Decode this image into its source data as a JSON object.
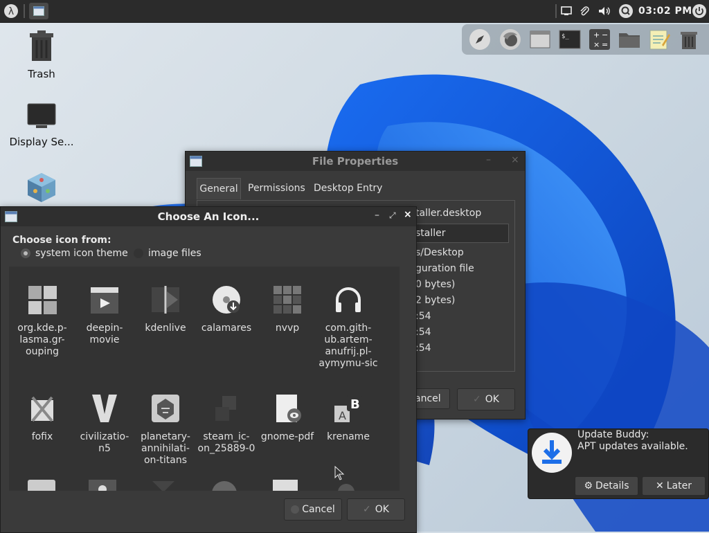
{
  "panel": {
    "clock": "03:02 PM"
  },
  "desktop": {
    "icons": [
      {
        "label": "Trash"
      },
      {
        "label": "Display Se..."
      }
    ]
  },
  "file_properties": {
    "title": "File Properties",
    "tabs": [
      "General",
      "Permissions",
      "Desktop Entry"
    ],
    "lines": [
      "taller.desktop",
      "staller",
      "s/Desktop",
      "guration file",
      "0 bytes)",
      "2 bytes)",
      ":54",
      ":54",
      ":54"
    ],
    "cancel_label": "ancel",
    "ok_label": "OK"
  },
  "icon_chooser": {
    "title": "Choose An Icon...",
    "choose_from_label": "Choose icon from:",
    "options": [
      "system icon theme",
      "image files"
    ],
    "selected_option": "system icon theme",
    "icons_row1": [
      "org.kde.p-lasma.gr-ouping",
      "deepin-movie",
      "kdenlive",
      "calamares",
      "nvvp",
      "com.gith-ub.artem-anufrij.pl-aymymu-sic"
    ],
    "icons_row2": [
      "fofix",
      "civilizatio-n5",
      "planetary-annihilati-on-titans",
      "steam_ic-on_25889-0",
      "gnome-pdf",
      "krename"
    ],
    "cancel_label": "Cancel",
    "ok_label": "OK"
  },
  "notification": {
    "title": "Update Buddy:",
    "message": "APT updates available.",
    "details_label": "Details",
    "later_label": "Later"
  }
}
